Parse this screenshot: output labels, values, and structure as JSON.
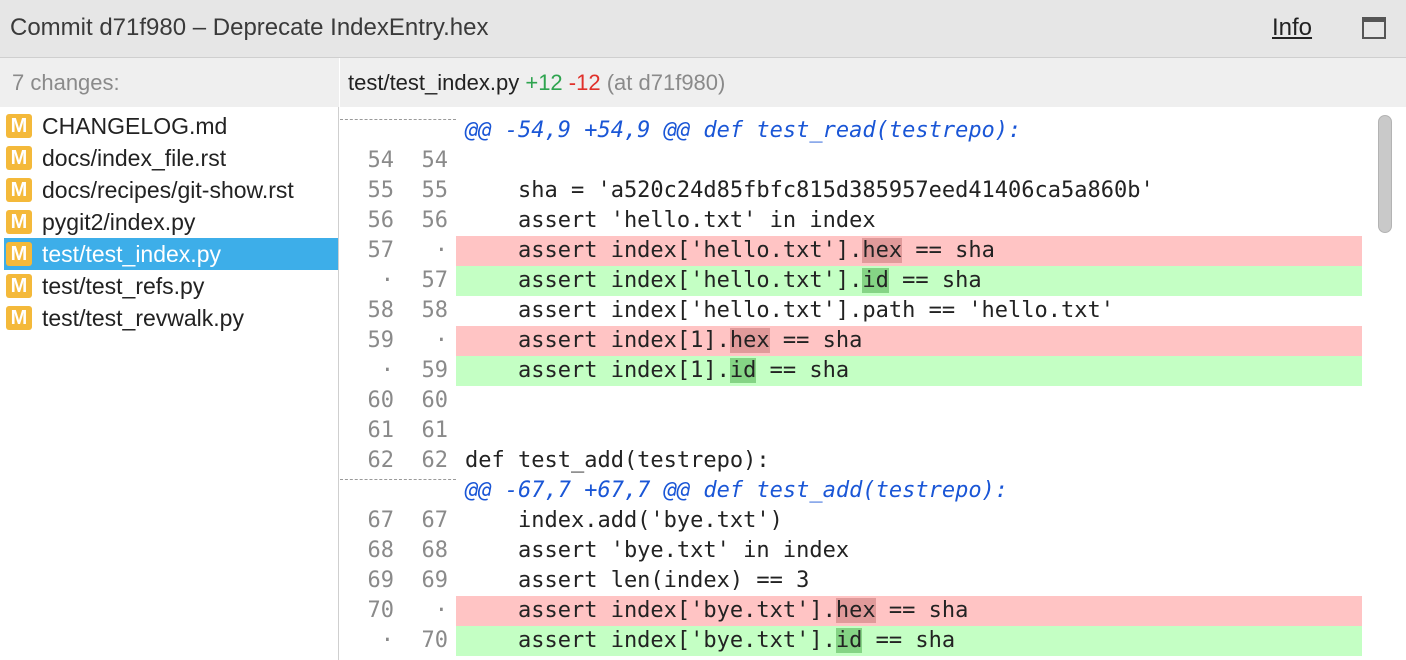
{
  "window": {
    "title": "Commit d71f980 – Deprecate IndexEntry.hex",
    "info_label": "Info",
    "maximize_icon": "maximize-icon"
  },
  "sidebar": {
    "header": "7 changes:",
    "files": [
      {
        "status": "M",
        "name": "CHANGELOG.md"
      },
      {
        "status": "M",
        "name": "docs/index_file.rst"
      },
      {
        "status": "M",
        "name": "docs/recipes/git-show.rst"
      },
      {
        "status": "M",
        "name": "pygit2/index.py"
      },
      {
        "status": "M",
        "name": "test/test_index.py"
      },
      {
        "status": "M",
        "name": "test/test_refs.py"
      },
      {
        "status": "M",
        "name": "test/test_revwalk.py"
      }
    ],
    "selected_index": 4
  },
  "diff": {
    "file": "test/test_index.py",
    "additions": "+12",
    "deletions": "-12",
    "at": "(at d71f980)",
    "lines": [
      {
        "type": "hunk",
        "old": "",
        "new": "",
        "code": "@@ -54,9 +54,9 @@ def test_read(testrepo):"
      },
      {
        "type": "ctx",
        "old": "54",
        "new": "54",
        "code": ""
      },
      {
        "type": "ctx",
        "old": "55",
        "new": "55",
        "code": "    sha = 'a520c24d85fbfc815d385957eed41406ca5a860b'"
      },
      {
        "type": "ctx",
        "old": "56",
        "new": "56",
        "code": "    assert 'hello.txt' in index"
      },
      {
        "type": "del",
        "old": "57",
        "new": "·",
        "pre": "    assert index['hello.txt'].",
        "hl": "hex",
        "post": " == sha"
      },
      {
        "type": "add",
        "old": "·",
        "new": "57",
        "pre": "    assert index['hello.txt'].",
        "hl": "id",
        "post": " == sha"
      },
      {
        "type": "ctx",
        "old": "58",
        "new": "58",
        "code": "    assert index['hello.txt'].path == 'hello.txt'"
      },
      {
        "type": "del",
        "old": "59",
        "new": "·",
        "pre": "    assert index[1].",
        "hl": "hex",
        "post": " == sha"
      },
      {
        "type": "add",
        "old": "·",
        "new": "59",
        "pre": "    assert index[1].",
        "hl": "id",
        "post": " == sha"
      },
      {
        "type": "ctx",
        "old": "60",
        "new": "60",
        "code": ""
      },
      {
        "type": "ctx",
        "old": "61",
        "new": "61",
        "code": ""
      },
      {
        "type": "ctx",
        "old": "62",
        "new": "62",
        "code": "def test_add(testrepo):"
      },
      {
        "type": "hunk",
        "old": "",
        "new": "",
        "code": "@@ -67,7 +67,7 @@ def test_add(testrepo):"
      },
      {
        "type": "ctx",
        "old": "67",
        "new": "67",
        "code": "    index.add('bye.txt')"
      },
      {
        "type": "ctx",
        "old": "68",
        "new": "68",
        "code": "    assert 'bye.txt' in index"
      },
      {
        "type": "ctx",
        "old": "69",
        "new": "69",
        "code": "    assert len(index) == 3"
      },
      {
        "type": "del",
        "old": "70",
        "new": "·",
        "pre": "    assert index['bye.txt'].",
        "hl": "hex",
        "post": " == sha"
      },
      {
        "type": "add",
        "old": "·",
        "new": "70",
        "pre": "    assert index['bye.txt'].",
        "hl": "id",
        "post": " == sha"
      }
    ]
  },
  "colors": {
    "badge": "#f4b93a",
    "selected": "#3daee9",
    "added_bg": "#c4ffc4",
    "removed_bg": "#ffc4c4",
    "hunk_text": "#1a56d6"
  }
}
